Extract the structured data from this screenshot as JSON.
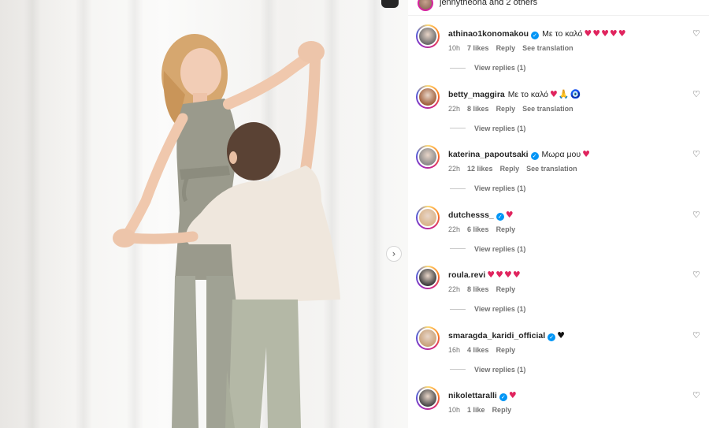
{
  "header": {
    "liked_by_text": "jennytheona and 2 others"
  },
  "post": {
    "next_arrow_glyph": "›"
  },
  "comments": [
    {
      "username": "athinao1konomakou",
      "verified": true,
      "text": "Με το καλό",
      "emoji": "♥♥♥♥♥",
      "emoji_color": "red",
      "time": "10h",
      "likes": "7 likes",
      "reply": "Reply",
      "translation": "See translation",
      "view_replies": "View replies (1)",
      "avatar_color": "#6b6b6b"
    },
    {
      "username": "betty_maggira",
      "verified": false,
      "text": "Με το καλό",
      "emoji": "♥🙏🧿",
      "emoji_color": "red",
      "time": "22h",
      "likes": "8 likes",
      "reply": "Reply",
      "translation": "See translation",
      "view_replies": "View replies (1)",
      "avatar_color": "#a0603c"
    },
    {
      "username": "katerina_papoutsaki",
      "verified": true,
      "text": "Μωρα μου",
      "emoji": "♥",
      "emoji_color": "red",
      "time": "22h",
      "likes": "12 likes",
      "reply": "Reply",
      "translation": "See translation",
      "view_replies": "View replies (1)",
      "avatar_color": "#8a8a8a"
    },
    {
      "username": "dutchesss_",
      "verified": true,
      "text": "",
      "emoji": "♥",
      "emoji_color": "red",
      "time": "22h",
      "likes": "6 likes",
      "reply": "Reply",
      "translation": "",
      "view_replies": "View replies (1)",
      "avatar_color": "#d9b48a"
    },
    {
      "username": "roula.revi",
      "verified": false,
      "text": "",
      "emoji": "♥♥♥♥",
      "emoji_color": "red",
      "time": "22h",
      "likes": "8 likes",
      "reply": "Reply",
      "translation": "",
      "view_replies": "View replies (1)",
      "avatar_color": "#3e3e3e"
    },
    {
      "username": "smaragda_karidi_official",
      "verified": true,
      "text": "",
      "emoji": "♥",
      "emoji_color": "black",
      "time": "16h",
      "likes": "4 likes",
      "reply": "Reply",
      "translation": "",
      "view_replies": "View replies (1)",
      "avatar_color": "#c8a27a"
    },
    {
      "username": "nikolettaralli",
      "verified": true,
      "text": "",
      "emoji": "♥",
      "emoji_color": "red",
      "time": "10h",
      "likes": "1 like",
      "reply": "Reply",
      "translation": "",
      "view_replies": "",
      "avatar_color": "#4a4a4a"
    }
  ],
  "icons": {
    "like": "heart-outline-icon",
    "verified": "verified-badge-icon"
  },
  "colors": {
    "heart_red": "#e0245e",
    "verified_blue": "#0095f6",
    "meta_gray": "#737373"
  }
}
